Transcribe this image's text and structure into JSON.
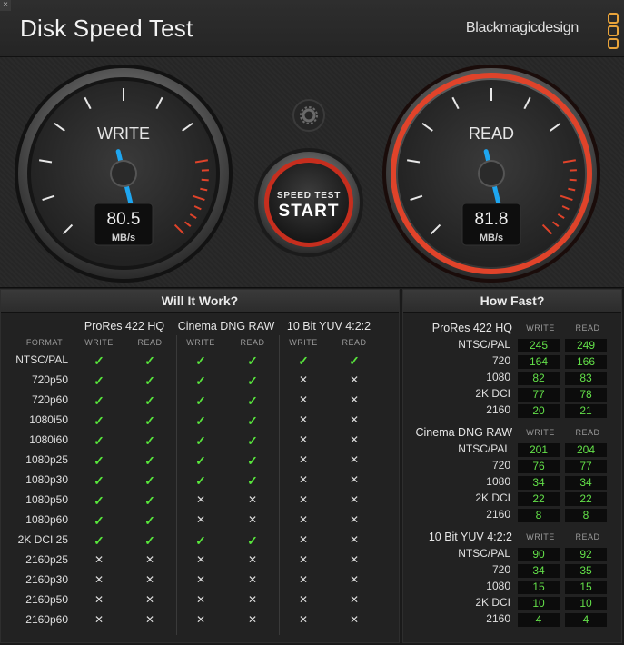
{
  "app": {
    "close_glyph": "×",
    "title": "Disk Speed Test",
    "brand": "Blackmagicdesign",
    "brand_color": "#e8a33a"
  },
  "gauges": {
    "write": {
      "label": "WRITE",
      "value": "80.5",
      "unit": "MB/s",
      "needle_fraction": 0.6
    },
    "read": {
      "label": "READ",
      "value": "81.8",
      "unit": "MB/s",
      "needle_fraction": 0.6
    },
    "start_button": {
      "line1": "SPEED TEST",
      "line2": "START"
    },
    "settings_icon": "gear-icon",
    "needle_color": "#1ea6f0",
    "red_zone_color": "#e0432a"
  },
  "will_it_work": {
    "title": "Will It Work?",
    "format_header": "FORMAT",
    "groups": [
      "ProRes 422 HQ",
      "Cinema DNG RAW",
      "10 Bit YUV 4:2:2"
    ],
    "sub_headers": [
      "WRITE",
      "READ",
      "WRITE",
      "READ",
      "WRITE",
      "READ"
    ],
    "rows": [
      {
        "format": "NTSC/PAL",
        "results": [
          true,
          true,
          true,
          true,
          true,
          true
        ]
      },
      {
        "format": "720p50",
        "results": [
          true,
          true,
          true,
          true,
          false,
          false
        ]
      },
      {
        "format": "720p60",
        "results": [
          true,
          true,
          true,
          true,
          false,
          false
        ]
      },
      {
        "format": "1080i50",
        "results": [
          true,
          true,
          true,
          true,
          false,
          false
        ]
      },
      {
        "format": "1080i60",
        "results": [
          true,
          true,
          true,
          true,
          false,
          false
        ]
      },
      {
        "format": "1080p25",
        "results": [
          true,
          true,
          true,
          true,
          false,
          false
        ]
      },
      {
        "format": "1080p30",
        "results": [
          true,
          true,
          true,
          true,
          false,
          false
        ]
      },
      {
        "format": "1080p50",
        "results": [
          true,
          true,
          false,
          false,
          false,
          false
        ]
      },
      {
        "format": "1080p60",
        "results": [
          true,
          true,
          false,
          false,
          false,
          false
        ]
      },
      {
        "format": "2K DCI 25",
        "results": [
          true,
          true,
          true,
          true,
          false,
          false
        ]
      },
      {
        "format": "2160p25",
        "results": [
          false,
          false,
          false,
          false,
          false,
          false
        ]
      },
      {
        "format": "2160p30",
        "results": [
          false,
          false,
          false,
          false,
          false,
          false
        ]
      },
      {
        "format": "2160p50",
        "results": [
          false,
          false,
          false,
          false,
          false,
          false
        ]
      },
      {
        "format": "2160p60",
        "results": [
          false,
          false,
          false,
          false,
          false,
          false
        ]
      }
    ],
    "check_glyph": "✓",
    "cross_glyph": "✕"
  },
  "how_fast": {
    "title": "How Fast?",
    "sections": [
      {
        "name": "ProRes 422 HQ",
        "write_header": "WRITE",
        "read_header": "READ",
        "rows": [
          {
            "format": "NTSC/PAL",
            "write": "245",
            "read": "249"
          },
          {
            "format": "720",
            "write": "164",
            "read": "166"
          },
          {
            "format": "1080",
            "write": "82",
            "read": "83"
          },
          {
            "format": "2K DCI",
            "write": "77",
            "read": "78"
          },
          {
            "format": "2160",
            "write": "20",
            "read": "21"
          }
        ]
      },
      {
        "name": "Cinema DNG RAW",
        "write_header": "WRITE",
        "read_header": "READ",
        "rows": [
          {
            "format": "NTSC/PAL",
            "write": "201",
            "read": "204"
          },
          {
            "format": "720",
            "write": "76",
            "read": "77"
          },
          {
            "format": "1080",
            "write": "34",
            "read": "34"
          },
          {
            "format": "2K DCI",
            "write": "22",
            "read": "22"
          },
          {
            "format": "2160",
            "write": "8",
            "read": "8"
          }
        ]
      },
      {
        "name": "10 Bit YUV 4:2:2",
        "write_header": "WRITE",
        "read_header": "READ",
        "rows": [
          {
            "format": "NTSC/PAL",
            "write": "90",
            "read": "92"
          },
          {
            "format": "720",
            "write": "34",
            "read": "35"
          },
          {
            "format": "1080",
            "write": "15",
            "read": "15"
          },
          {
            "format": "2K DCI",
            "write": "10",
            "read": "10"
          },
          {
            "format": "2160",
            "write": "4",
            "read": "4"
          }
        ]
      }
    ]
  }
}
